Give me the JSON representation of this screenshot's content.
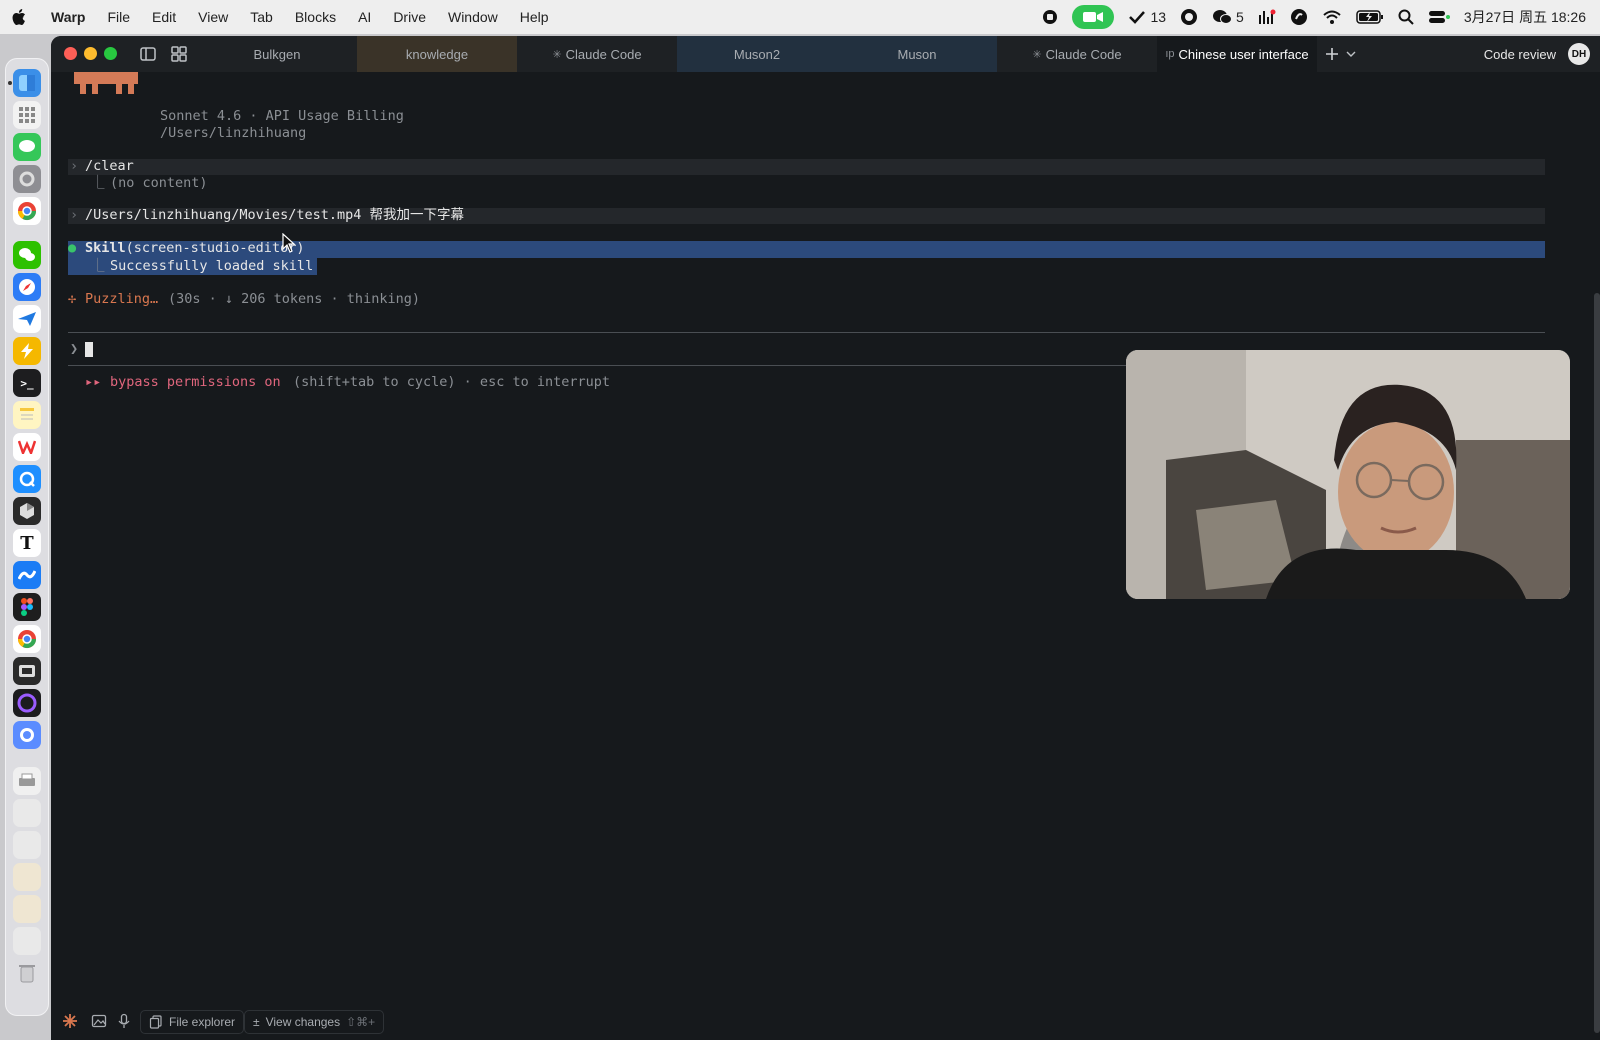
{
  "menubar": {
    "app_name": "Warp",
    "menus": [
      "File",
      "Edit",
      "View",
      "Tab",
      "Blocks",
      "AI",
      "Drive",
      "Window",
      "Help"
    ],
    "status": {
      "notifications_count": "13",
      "wechat_count": "5",
      "clock": "3月27日 周五 18:26"
    }
  },
  "tabs": [
    {
      "label": "Bulkgen"
    },
    {
      "label": "knowledge"
    },
    {
      "label": "Claude Code",
      "prefix": "✳"
    },
    {
      "label": "Muson2"
    },
    {
      "label": "Muson"
    },
    {
      "label": "Claude Code",
      "prefix": "✳"
    },
    {
      "label": "Chinese user interface",
      "prefix": "ıp"
    }
  ],
  "toolbar": {
    "code_review_label": "Code review",
    "avatar_text": "DH"
  },
  "terminal": {
    "header_model": "Sonnet 4.6 · API Usage Billing",
    "header_path": "/Users/linzhihuang",
    "block1_cmd": "/clear",
    "block1_out": "(no content)",
    "block2_cmd": "/Users/linzhihuang/Movies/test.mp4 帮我加一下字幕",
    "skill_name": "Skill",
    "skill_arg": "(screen-studio-editor)",
    "skill_result": "Successfully loaded skill",
    "spinner_glyph": "✢",
    "status_word": "Puzzling…",
    "status_detail": "(30s · ↓ 206 tokens · thinking)",
    "prompt_glyph": "❯",
    "mode_glyph": "▸▸",
    "mode_label": "bypass permissions on",
    "mode_hint": "(shift+tab to cycle) · esc to interrupt"
  },
  "statusbar": {
    "file_explorer": "File explorer",
    "view_changes": "View changes",
    "view_changes_shortcut": "⇧⌘+"
  },
  "colors": {
    "accent_green": "#30c453",
    "claude_orange": "#d47a57",
    "bypass_pink": "#e0667d",
    "selection_blue": "#2c4a7c"
  }
}
